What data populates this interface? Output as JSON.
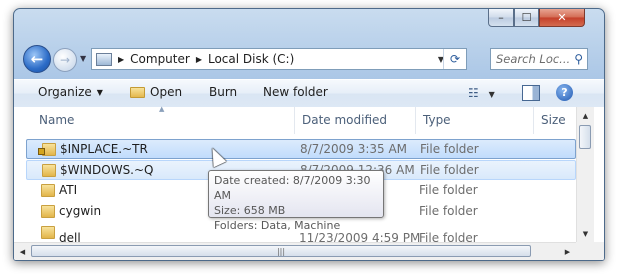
{
  "window": {
    "controls": {
      "minimize": "–",
      "maximize": "☐",
      "close": "✕"
    }
  },
  "nav": {
    "back_glyph": "←",
    "forward_glyph": "→",
    "breadcrumb": [
      "Computer",
      "Local Disk (C:)"
    ],
    "refresh_glyph": "⟳",
    "search_placeholder": "Search Loc...",
    "search_glyph": "⚲"
  },
  "toolbar": {
    "organize": "Organize",
    "open": "Open",
    "burn": "Burn",
    "new_folder": "New folder",
    "views_glyph": "☷",
    "help_glyph": "?"
  },
  "columns": [
    "Name",
    "Date modified",
    "Type",
    "Size"
  ],
  "files": [
    {
      "name": "$INPLACE.~TR",
      "date": "8/7/2009 3:35 AM",
      "type": "File folder",
      "locked": true
    },
    {
      "name": "$WINDOWS.~Q",
      "date": "8/7/2009 12:36 AM",
      "type": "File folder",
      "locked": false
    },
    {
      "name": "ATI",
      "date": "",
      "type": "File folder",
      "locked": false
    },
    {
      "name": "cygwin",
      "date": "",
      "type": "File folder",
      "locked": false
    },
    {
      "name": "dell",
      "date": "11/23/2009 4:59 PM",
      "type": "File folder",
      "locked": false
    }
  ],
  "tooltip": {
    "line1": "Date created: 8/7/2009 3:30 AM",
    "line2": "Size: 658 MB",
    "line3": "Folders: Data, Machine"
  },
  "scroll": {
    "h_grip": "|||",
    "up": "▲",
    "down": "▼",
    "left": "◀",
    "right": "▶"
  }
}
